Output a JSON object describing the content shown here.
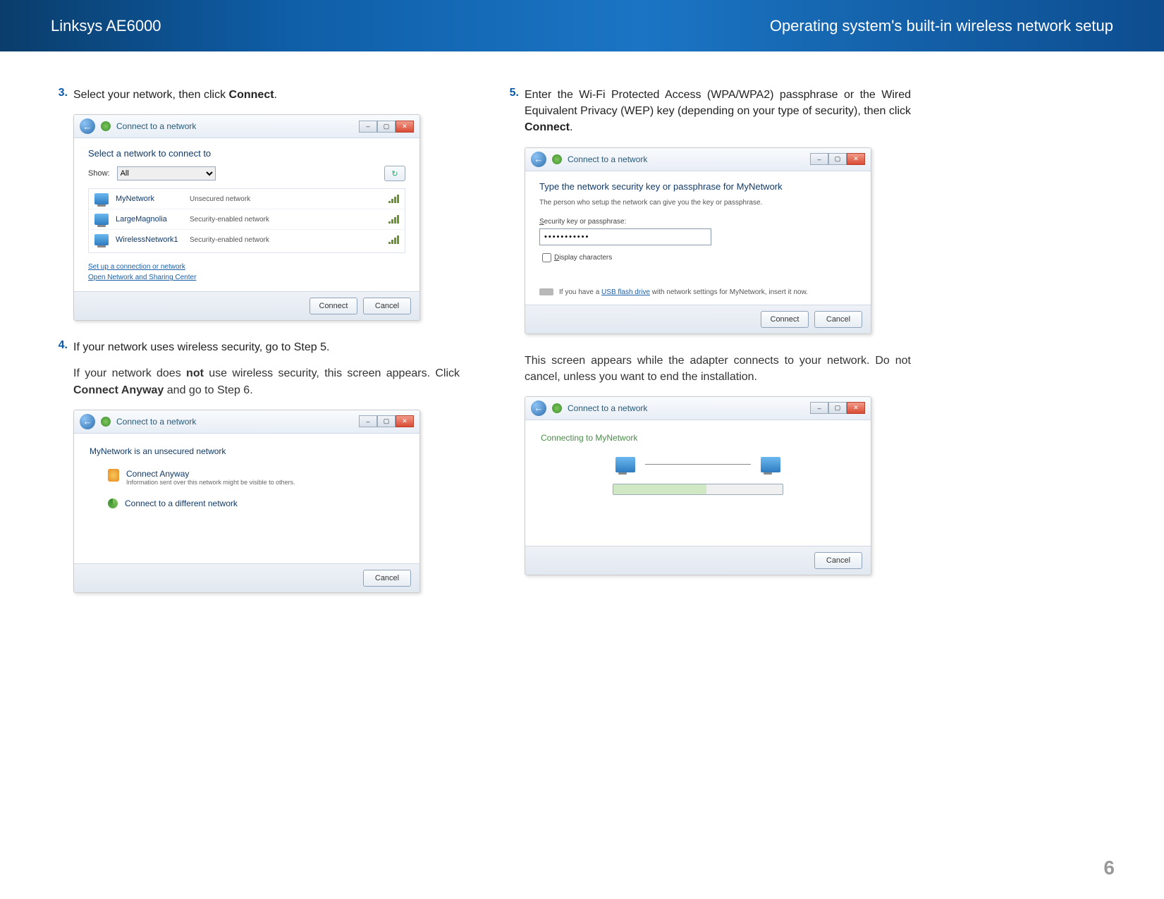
{
  "header": {
    "product": "Linksys AE6000",
    "section": "Operating system's built-in wireless network setup"
  },
  "page_number": "6",
  "steps": {
    "s3": {
      "num": "3.",
      "text_a": "Select your network, then click ",
      "bold": "Connect",
      "text_b": "."
    },
    "s4": {
      "num": "4.",
      "line1": "If your network uses wireless security, go to Step 5.",
      "line2a": "If your network does ",
      "line2b": "not",
      "line2c": " use wireless security, this screen appears. Click ",
      "line2d": "Connect Anyway",
      "line2e": " and go to Step 6."
    },
    "s5": {
      "num": "5.",
      "t1": "Enter the Wi-Fi Protected Access (WPA/WPA2) passphrase or the  Wired Equivalent Privacy (WEP) key (depending on your type of security), then click ",
      "b": "Connect",
      "t2": "."
    },
    "s5_follow": "This screen appears while the adapter connects to your network. Do not cancel, unless you want to end the installation."
  },
  "dlg_common": {
    "title": "Connect to a network",
    "connect": "Connect",
    "cancel": "Cancel"
  },
  "dlg1": {
    "heading": "Select a network to connect to",
    "show_label": "Show:",
    "show_value": "All",
    "refresh": "↻",
    "networks": [
      {
        "name": "MyNetwork",
        "sec": "Unsecured network"
      },
      {
        "name": "LargeMagnolia",
        "sec": "Security-enabled network"
      },
      {
        "name": "WirelessNetwork1",
        "sec": "Security-enabled network"
      }
    ],
    "link1": "Set up a connection or network",
    "link2": "Open Network and Sharing Center"
  },
  "dlg2": {
    "heading": "MyNetwork is an unsecured network",
    "opt1_t": "Connect Anyway",
    "opt1_s": "Information sent over this network might be visible to others.",
    "opt2_t": "Connect to a different network"
  },
  "dlg3": {
    "heading": "Type the network security key or passphrase for MyNetwork",
    "sub": "The person who setup the network can give you the key or passphrase.",
    "sec_label_a": "S",
    "sec_label_b": "ecurity key or passphrase:",
    "value": "•••••••••••",
    "disp_a": "D",
    "disp_b": "isplay characters",
    "usb_a": "If you have a ",
    "usb_link": "USB flash drive",
    "usb_b": " with network settings for MyNetwork, insert it now."
  },
  "dlg4": {
    "heading": "Connecting to MyNetwork"
  }
}
